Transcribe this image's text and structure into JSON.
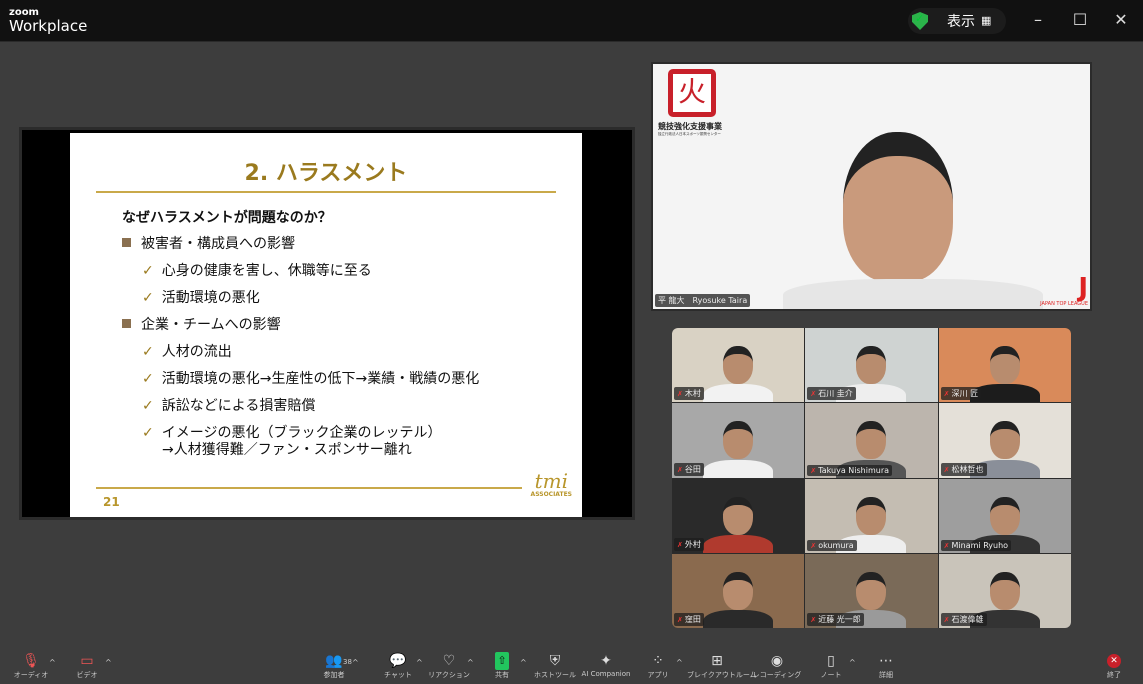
{
  "app": {
    "brand_top": "zoom",
    "brand_bottom": "Workplace",
    "view_label": "表示"
  },
  "colors": {
    "accent_green": "#2bb44a",
    "slide_gold": "#9a7a1e",
    "end_red": "#c8202a"
  },
  "slide": {
    "title": "2. ハラスメント",
    "question": "なぜハラスメントが問題なのか？",
    "items": [
      {
        "level": 1,
        "text": "被害者・構成員への影響"
      },
      {
        "level": 2,
        "text": "心身の健康を害し、休職等に至る"
      },
      {
        "level": 2,
        "text": "活動環境の悪化"
      },
      {
        "level": 1,
        "text": "企業・チームへの影響"
      },
      {
        "level": 2,
        "text": "人材の流出"
      },
      {
        "level": 2,
        "text": "活動環境の悪化→生産性の低下→業績・戦績の悪化"
      },
      {
        "level": 2,
        "text": "訴訟などによる損害賠償"
      },
      {
        "level": 2,
        "text": "イメージの悪化（ブラック企業のレッテル）"
      },
      {
        "level": 3,
        "text": "→人材獲得難／ファン・スポンサー離れ"
      }
    ],
    "page_number": "21",
    "logo_text": "tmi",
    "logo_sub": "ASSOCIATES"
  },
  "speaker": {
    "name": "平 龍大　Ryosuke Taira",
    "bg_logo_text": "競技強化支援事業",
    "bg_logo_sub": "独立行政法人日本スポーツ振興センター",
    "corner_logo_text": "JAPAN TOP LEAGUE"
  },
  "participants": [
    {
      "name": "木村",
      "bg": "#d9d2c4",
      "shirt": "#f2f2f2"
    },
    {
      "name": "石川 圭介",
      "bg": "#cfd3d2",
      "shirt": "#eeeeee"
    },
    {
      "name": "深川 匠",
      "bg": "#d98a5a",
      "shirt": "#1c1c1c"
    },
    {
      "name": "谷田",
      "bg": "#a8a8a8",
      "shirt": "#f0f0f0"
    },
    {
      "name": "Takuya Nishimura",
      "bg": "#bcb5ad",
      "shirt": "#555555"
    },
    {
      "name": "松林哲也",
      "bg": "#e4e0d8",
      "shirt": "#8a8f99"
    },
    {
      "name": "外村",
      "bg": "#2a2a2a",
      "shirt": "#b03a2e"
    },
    {
      "name": "okumura",
      "bg": "#c4bdb2",
      "shirt": "#eeeeee"
    },
    {
      "name": "Minami Ryuho",
      "bg": "#9e9e9e",
      "shirt": "#333333"
    },
    {
      "name": "窪田",
      "bg": "#8a6a4e",
      "shirt": "#2a2a2a"
    },
    {
      "name": "近藤 光一郎",
      "bg": "#7a6a58",
      "shirt": "#9a9a9a"
    },
    {
      "name": "石渡偉雄",
      "bg": "#c9c4ba",
      "shirt": "#333333"
    }
  ],
  "toolbar": {
    "audio": "オーディオ",
    "video": "ビデオ",
    "participants": "参加者",
    "participants_count": "38",
    "chat": "チャット",
    "reactions": "リアクション",
    "share": "共有",
    "host_tools": "ホストツール",
    "ai_companion": "AI Companion",
    "apps": "アプリ",
    "breakout": "ブレイクアウトルーム",
    "recording": "レコーディング",
    "notes": "ノート",
    "more": "詳細",
    "end": "終了"
  }
}
